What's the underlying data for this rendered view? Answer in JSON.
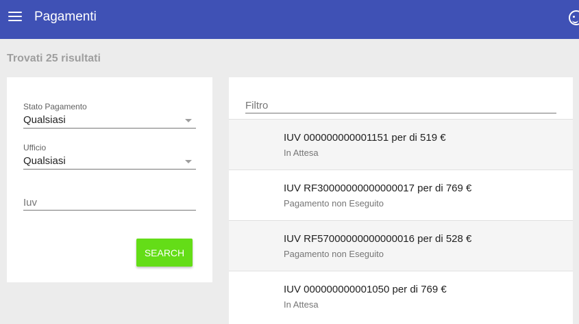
{
  "appbar": {
    "title": "Pagamenti",
    "menu_icon": "menu-icon",
    "account_icon": "account-circle-icon",
    "color": "#3f51b5"
  },
  "results": {
    "count_text": "Trovati 25 risultati"
  },
  "filters": {
    "stato_label": "Stato Pagamento",
    "stato_value": "Qualsiasi",
    "ufficio_label": "Ufficio",
    "ufficio_value": "Qualsiasi",
    "iuv_placeholder": "Iuv",
    "search_label": "Search",
    "search_color": "#64dd17"
  },
  "list": {
    "filter_placeholder": "Filtro",
    "items": [
      {
        "title": "IUV 000000000001151 per di 519 €",
        "status": "In Attesa"
      },
      {
        "title": "IUV RF30000000000000017 per di 769 €",
        "status": "Pagamento non Eseguito"
      },
      {
        "title": "IUV RF57000000000000016 per di 528 €",
        "status": "Pagamento non Eseguito"
      },
      {
        "title": "IUV 000000000001050 per di 769 €",
        "status": "In Attesa"
      }
    ]
  }
}
